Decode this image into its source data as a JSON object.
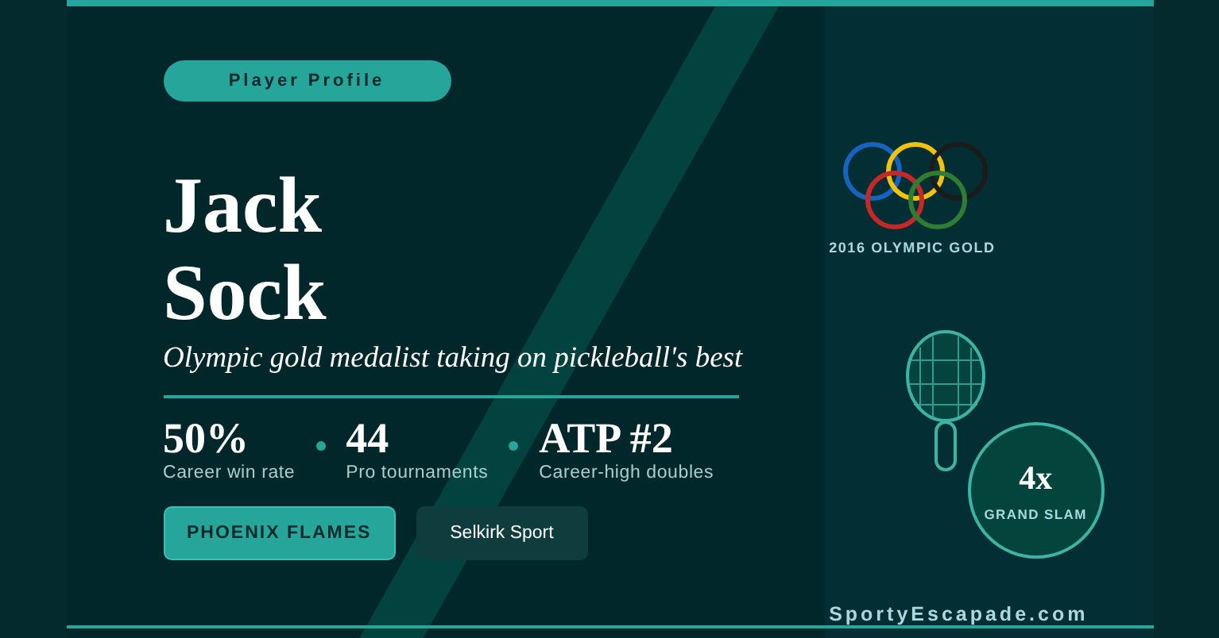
{
  "badge": "Player Profile",
  "name_lines": [
    "Jack",
    "Sock"
  ],
  "tagline": "Olympic gold medalist taking on pickleball's best",
  "stats": [
    {
      "value": "50%",
      "label": "Career win rate"
    },
    {
      "value": "44",
      "label": "Pro tournaments"
    },
    {
      "value": "ATP #2",
      "label": "Career-high doubles"
    }
  ],
  "buttons": [
    {
      "label": "PHOENIX FLAMES",
      "kind": "primary"
    },
    {
      "label": "Selkirk Sport",
      "kind": "secondary"
    }
  ],
  "olympic": {
    "label": "2016 OLYMPIC GOLD"
  },
  "grand_slam": {
    "count": "4x",
    "label": "GRAND SLAM"
  },
  "site": "SportyEscapade.com"
}
